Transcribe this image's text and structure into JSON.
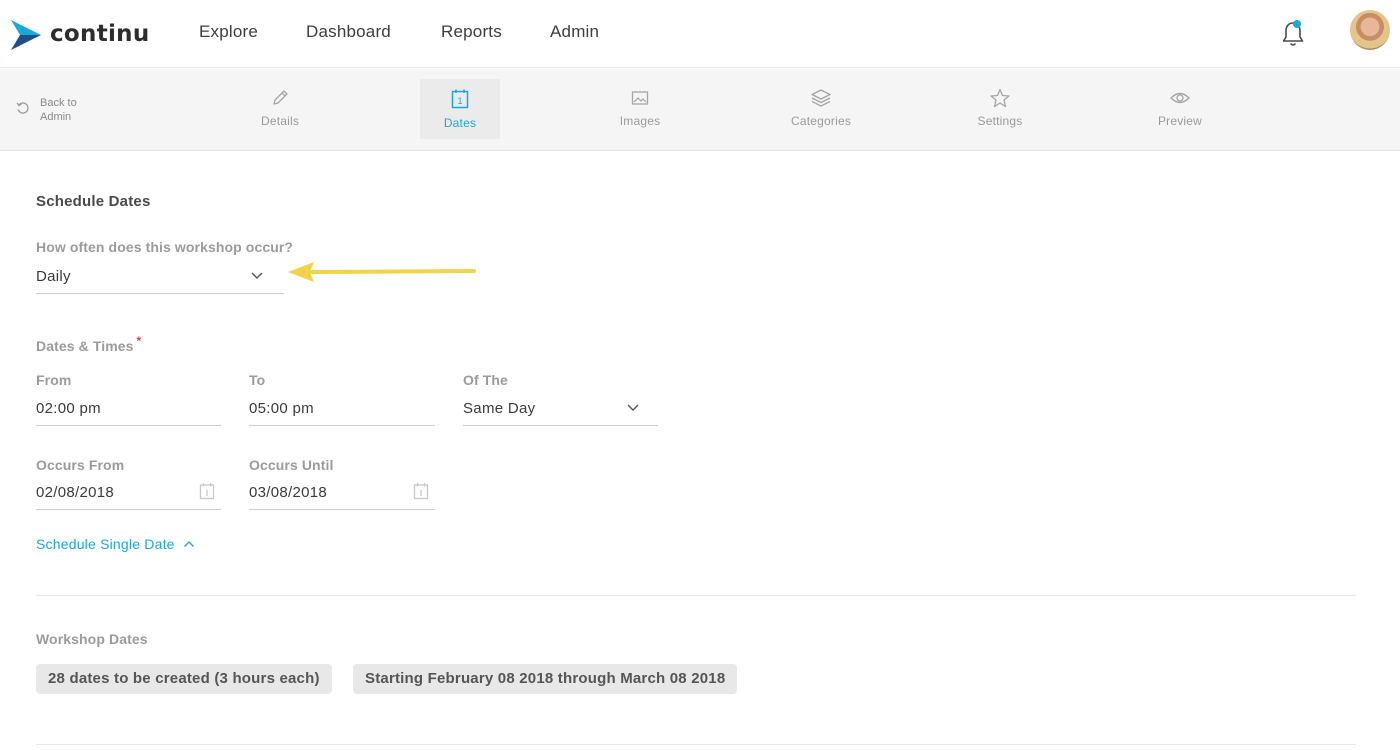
{
  "brand": {
    "name": "continu",
    "logo_color": "#1e6aa8"
  },
  "nav": {
    "links": [
      "Explore",
      "Dashboard",
      "Reports",
      "Admin"
    ],
    "notification_icon": "bell-icon",
    "accent": "#1ba7d8"
  },
  "subnav": {
    "back_label": "Back to Admin",
    "tabs": [
      {
        "label": "Details",
        "icon": "pencil-icon"
      },
      {
        "label": "Dates",
        "icon": "calendar-icon",
        "active": true
      },
      {
        "label": "Images",
        "icon": "image-icon"
      },
      {
        "label": "Categories",
        "icon": "layers-icon"
      },
      {
        "label": "Settings",
        "icon": "star-icon"
      },
      {
        "label": "Preview",
        "icon": "eye-icon"
      }
    ]
  },
  "schedule": {
    "title": "Schedule Dates",
    "frequency_label": "How often does this workshop occur?",
    "frequency_value": "Daily",
    "dates_times_label": "Dates & Times",
    "required_mark": "*",
    "from_label": "From",
    "from_value": "02:00 pm",
    "to_label": "To",
    "to_value": "05:00 pm",
    "of_the_label": "Of The",
    "of_the_value": "Same Day",
    "occurs_from_label": "Occurs From",
    "occurs_from_value": "02/08/2018",
    "occurs_until_label": "Occurs Until",
    "occurs_until_value": "03/08/2018",
    "single_date_link": "Schedule Single Date"
  },
  "workshop_dates": {
    "label": "Workshop Dates",
    "count_chip": "28 dates to be created (3 hours each)",
    "range_chip": "Starting February 08 2018 through March 08 2018"
  },
  "annotation": {
    "arrow_color": "#f3d34a"
  }
}
